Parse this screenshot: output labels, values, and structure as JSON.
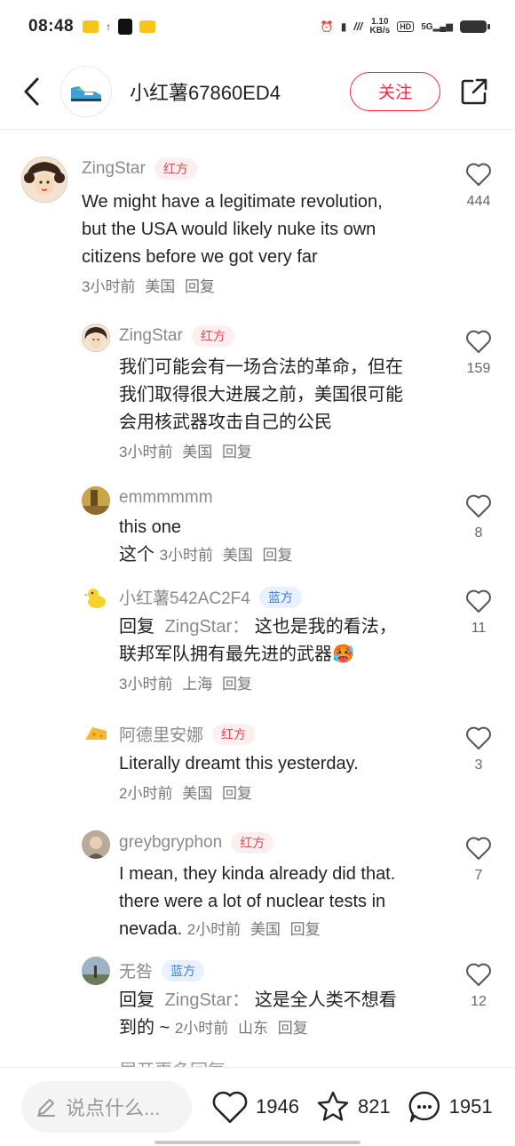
{
  "status_bar": {
    "time": "08:48",
    "speed_value": "1.10",
    "speed_unit": "KB/s",
    "hd": "HD",
    "network": "5G"
  },
  "header": {
    "author_name": "小红薯67860ED4",
    "follow_label": "关注"
  },
  "comments": [
    {
      "name": "ZingStar",
      "tag": "红方",
      "lines": [
        "We might have a legitimate revolution,",
        "but the USA would likely nuke its own",
        "citizens before we got very far"
      ],
      "time": "3小时前",
      "location": "美国",
      "reply": "回复",
      "likes": "444"
    },
    {
      "name": "ZingStar",
      "tag": "红方",
      "lines": [
        "我们可能会有一场合法的革命，但在",
        "我们取得很大进展之前，美国很可能",
        "会用核武器攻击自己的公民"
      ],
      "time": "3小时前",
      "location": "美国",
      "reply": "回复",
      "likes": "159"
    },
    {
      "name": "emmmmmm",
      "lines": [
        "this one"
      ],
      "inline_text": "这个",
      "time": "3小时前",
      "location": "美国",
      "reply": "回复",
      "likes": "8"
    },
    {
      "name": "小红薯542AC2F4",
      "tag": "蓝方",
      "reply_prefix": "回复",
      "reply_to": "ZingStar：",
      "lines": [
        "这也是我的看法，",
        "联邦军队拥有最先进的武器"
      ],
      "emoji": "🥵",
      "time": "3小时前",
      "location": "上海",
      "reply": "回复",
      "likes": "11"
    },
    {
      "name": "阿德里安娜",
      "tag": "红方",
      "lines": [
        "Literally dreamt this yesterday."
      ],
      "time": "2小时前",
      "location": "美国",
      "reply": "回复",
      "likes": "3"
    },
    {
      "name": "greybgryphon",
      "tag": "红方",
      "lines": [
        "I mean, they kinda already did that.",
        "there were a lot of nuclear tests in"
      ],
      "inline_text": "nevada.",
      "time": "2小时前",
      "location": "美国",
      "reply": "回复",
      "likes": "7"
    },
    {
      "name": "无咎",
      "tag": "蓝方",
      "reply_prefix": "回复",
      "reply_to": "ZingStar：",
      "lines": [
        "这是全人类不想看"
      ],
      "inline_text": "到的 ~",
      "time": "2小时前",
      "location": "山东",
      "reply": "回复",
      "likes": "12"
    }
  ],
  "more_replies_peek": "展开更多回复",
  "bottom_bar": {
    "input_placeholder": "说点什么...",
    "likes": "1946",
    "collects": "821",
    "comments": "1951"
  },
  "colors": {
    "accent": "#ff2442",
    "red_tag_bg": "#fdeff0",
    "blue_tag_bg": "#e8f1fd"
  }
}
